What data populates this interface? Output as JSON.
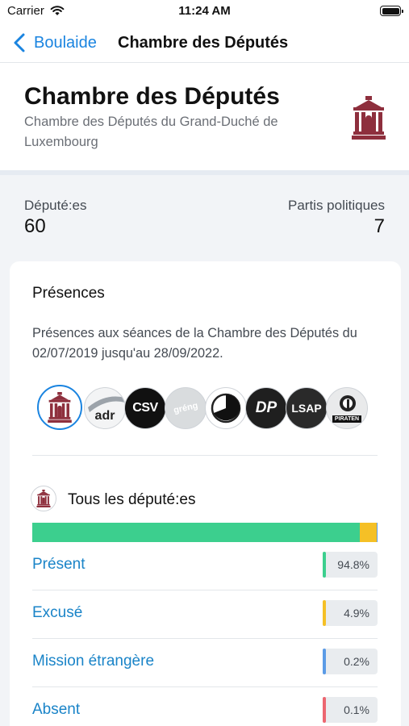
{
  "status_bar": {
    "carrier": "Carrier",
    "time": "11:24 AM"
  },
  "nav": {
    "back_label": "Boulaide",
    "title": "Chambre des Députés"
  },
  "header": {
    "title": "Chambre des Députés",
    "subtitle": "Chambre des Députés du Grand-Duché de Luxembourg",
    "logo_icon": "parliament-building-icon"
  },
  "stats": {
    "deputies_label": "Député:es",
    "deputies_value": "60",
    "parties_label": "Partis politiques",
    "parties_value": "7"
  },
  "card": {
    "title": "Présences",
    "description": "Présences aux séances de la Chambre des Députés du 02/07/2019 jusqu'au 28/09/2022.",
    "party_logos": [
      {
        "name": "chamber",
        "text": "",
        "selected": true
      },
      {
        "name": "adr",
        "text": "adr"
      },
      {
        "name": "csv",
        "text": "CSV"
      },
      {
        "name": "dei-greng",
        "text": "gréng"
      },
      {
        "name": "dei-lenk",
        "text": ""
      },
      {
        "name": "dp",
        "text": "DP"
      },
      {
        "name": "lsap",
        "text": "LSAP"
      },
      {
        "name": "piraten",
        "text": "PIRATEN"
      }
    ],
    "section_title": "Tous les député:es",
    "attendance": [
      {
        "label": "Présent",
        "value": "94.8%",
        "share": 94.8,
        "color": "#3ccf8e"
      },
      {
        "label": "Excusé",
        "value": "4.9%",
        "share": 4.9,
        "color": "#f5c026"
      },
      {
        "label": "Mission étrangère",
        "value": "0.2%",
        "share": 0.2,
        "color": "#5b9be6"
      },
      {
        "label": "Absent",
        "value": "0.1%",
        "share": 0.1,
        "color": "#ec6670"
      }
    ]
  }
}
